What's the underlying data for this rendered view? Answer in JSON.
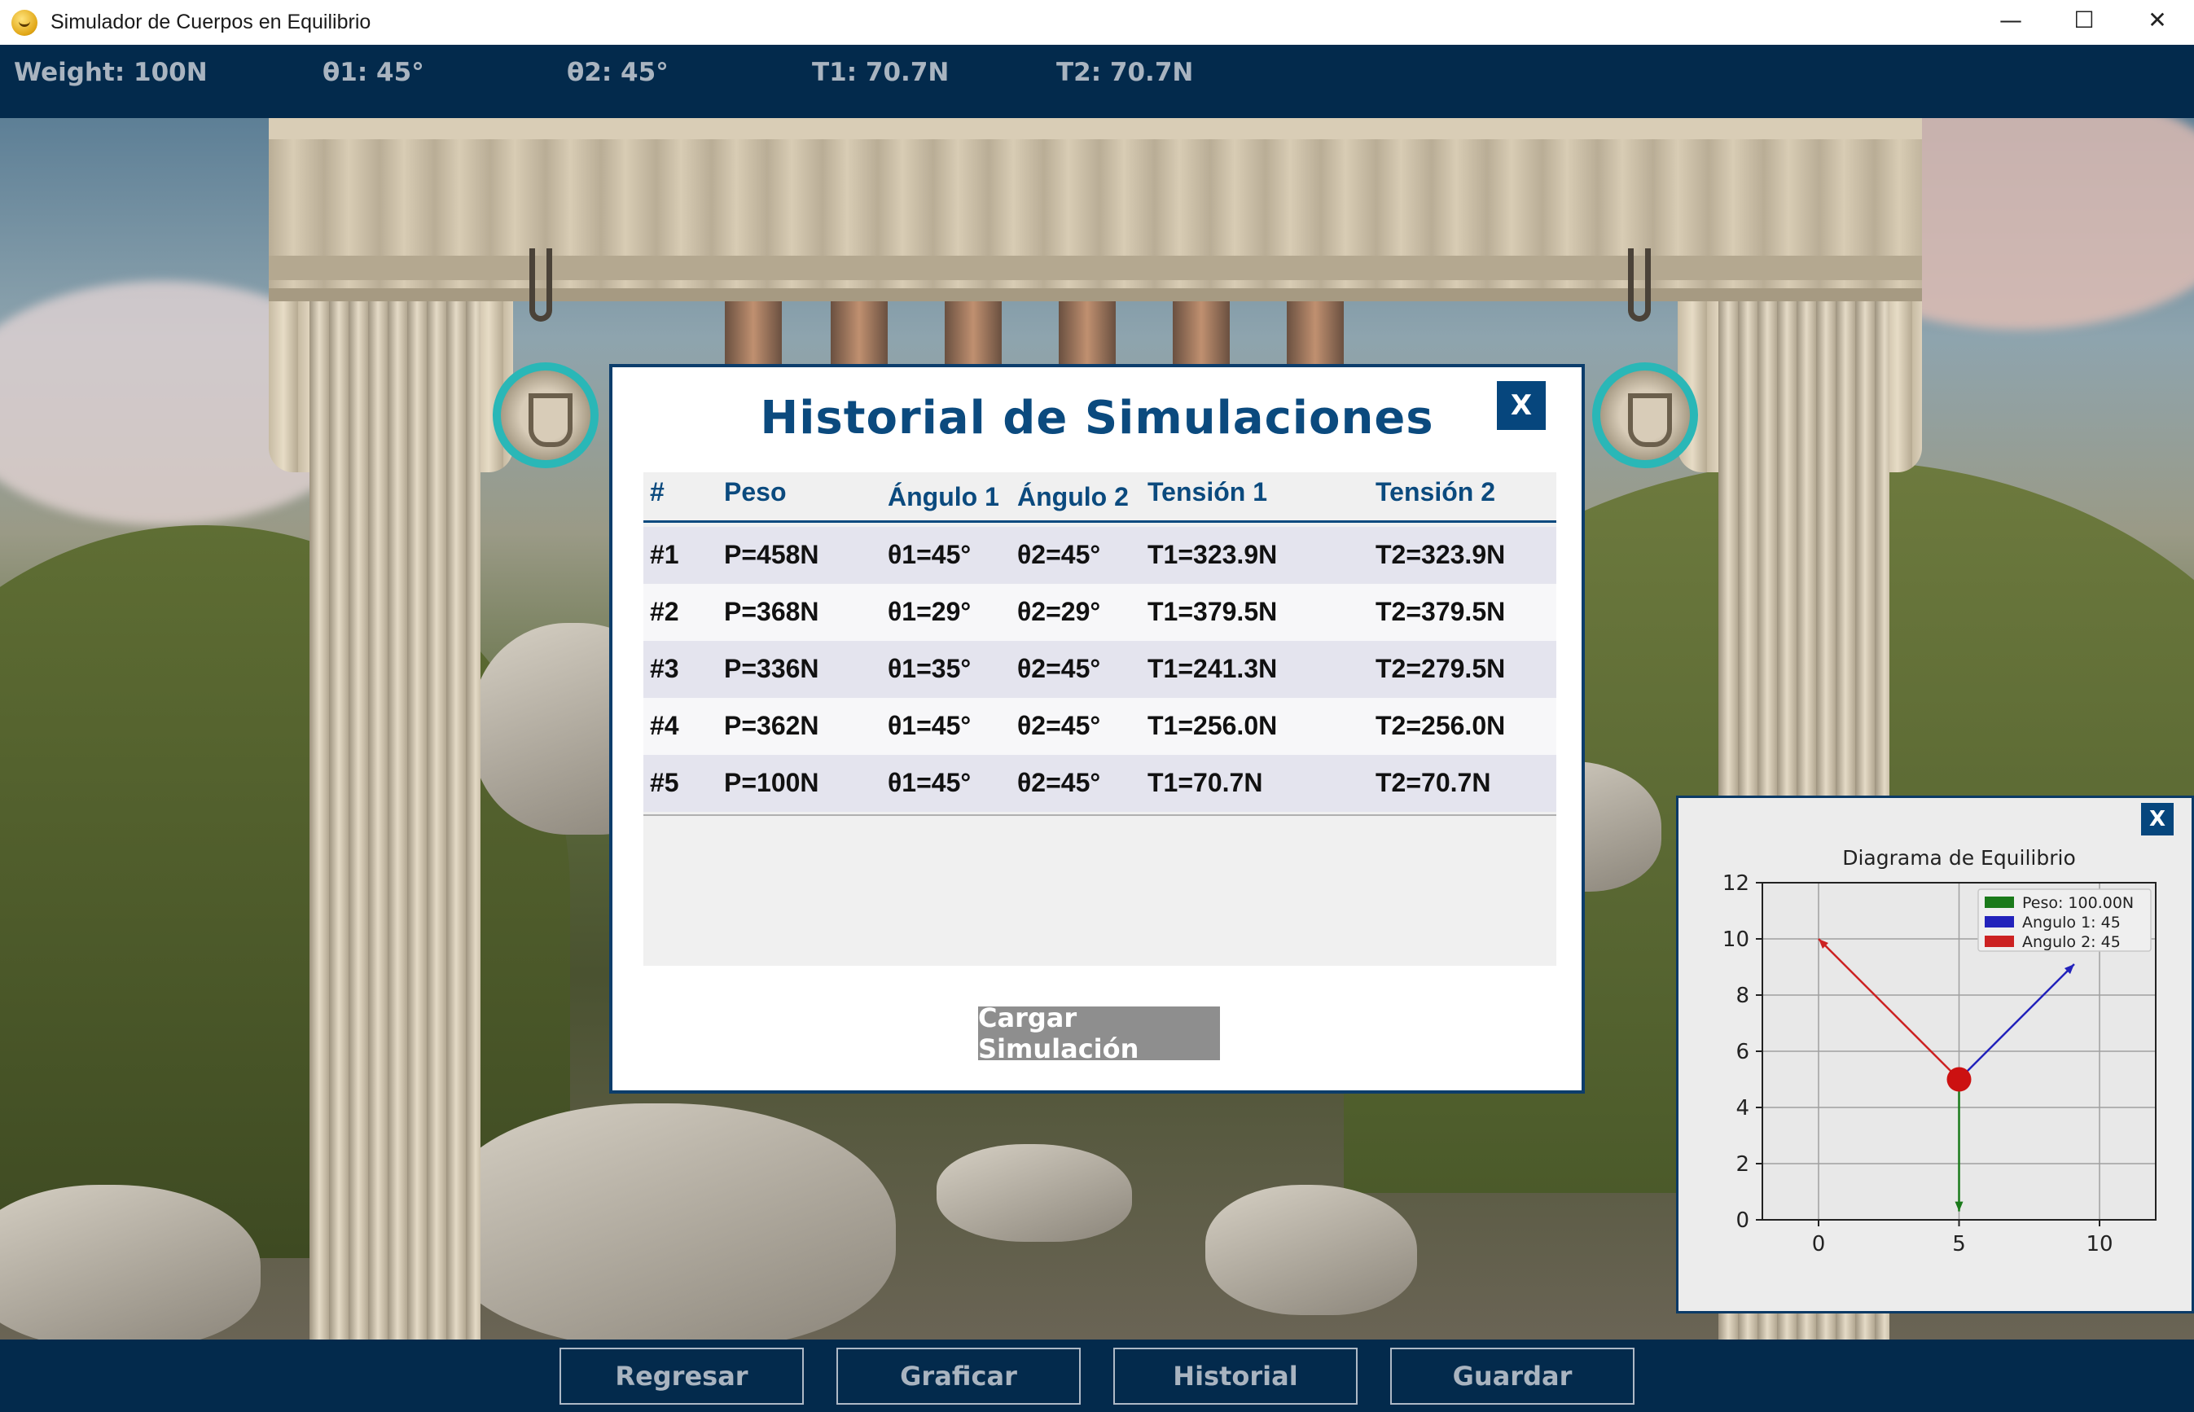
{
  "window": {
    "title": "Simulador de Cuerpos en Equilibrio",
    "minimize": "—",
    "maximize": "☐",
    "close": "✕"
  },
  "status": {
    "weight": "Weight: 100N",
    "theta1": "θ1: 45°",
    "theta2": "θ2: 45°",
    "t1": "T1: 70.7N",
    "t2": "T2: 70.7N"
  },
  "history": {
    "title": "Historial de Simulaciones",
    "close_label": "X",
    "headers": [
      "#",
      "Peso",
      "Ángulo 1",
      "Ángulo 2",
      "Tensión 1",
      "Tensión 2"
    ],
    "rows": [
      [
        "#1",
        "P=458N",
        "θ1=45°",
        "θ2=45°",
        "T1=323.9N",
        "T2=323.9N"
      ],
      [
        "#2",
        "P=368N",
        "θ1=29°",
        "θ2=29°",
        "T1=379.5N",
        "T2=379.5N"
      ],
      [
        "#3",
        "P=336N",
        "θ1=35°",
        "θ2=45°",
        "T1=241.3N",
        "T2=279.5N"
      ],
      [
        "#4",
        "P=362N",
        "θ1=45°",
        "θ2=45°",
        "T1=256.0N",
        "T2=256.0N"
      ],
      [
        "#5",
        "P=100N",
        "θ1=45°",
        "θ2=45°",
        "T1=70.7N",
        "T2=70.7N"
      ]
    ],
    "load_button": "Cargar Simulación"
  },
  "chart_panel": {
    "close_label": "X"
  },
  "chart_data": {
    "type": "line",
    "title": "Diagrama de Equilibrio",
    "xlabel": "",
    "ylabel": "",
    "xlim": [
      -2,
      12
    ],
    "ylim": [
      0,
      12
    ],
    "xticks": [
      0,
      5,
      10
    ],
    "yticks": [
      0,
      2,
      4,
      6,
      8,
      10,
      12
    ],
    "grid": true,
    "legend_position": "top-right",
    "node": {
      "x": 5,
      "y": 5
    },
    "series": [
      {
        "name": "Peso: 100.00N",
        "color": "#1a7a1a",
        "points": [
          [
            5,
            5
          ],
          [
            5,
            0.3
          ]
        ]
      },
      {
        "name": "Angulo 1: 45",
        "color": "#2222bb",
        "points": [
          [
            5,
            5
          ],
          [
            9.1,
            9.1
          ]
        ]
      },
      {
        "name": "Angulo 2: 45",
        "color": "#cc2222",
        "points": [
          [
            5,
            5
          ],
          [
            0,
            10
          ]
        ]
      }
    ]
  },
  "bottom": {
    "back": "Regresar",
    "plot": "Graficar",
    "history": "Historial",
    "save": "Guardar"
  }
}
